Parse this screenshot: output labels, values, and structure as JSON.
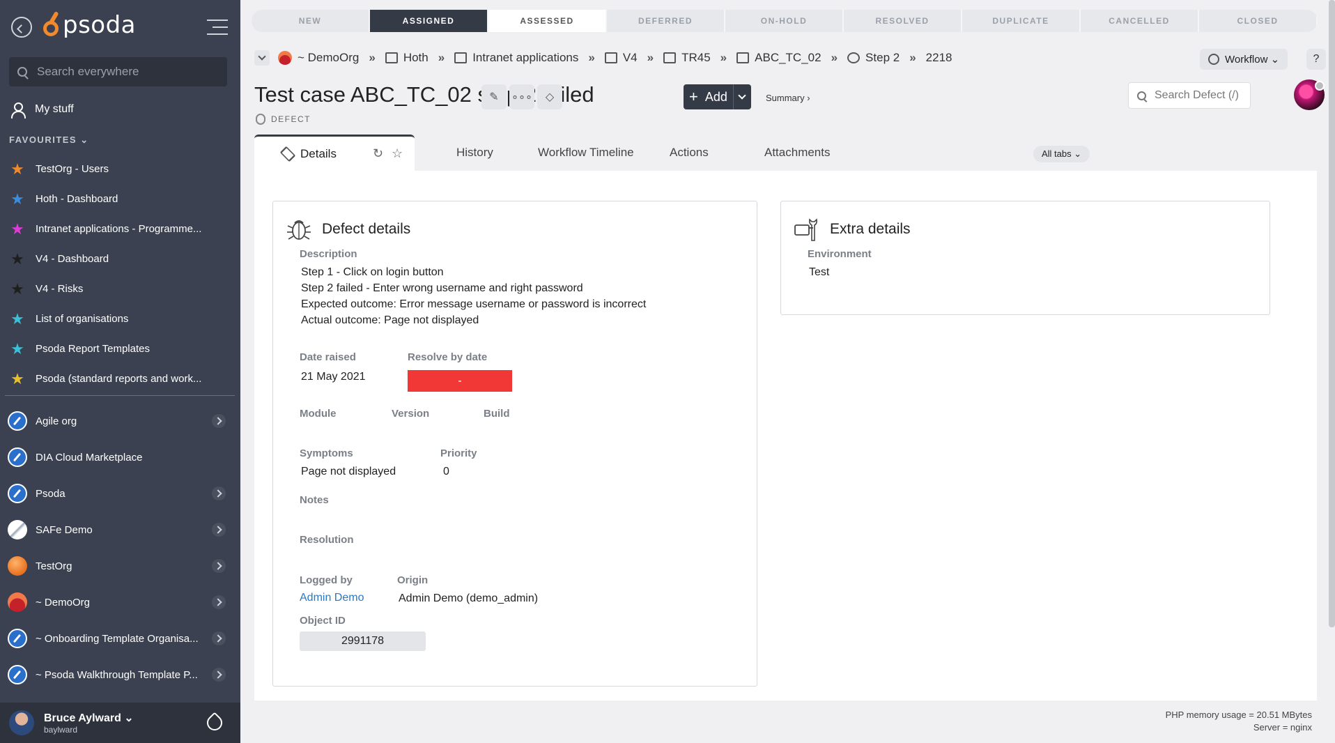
{
  "sidebar": {
    "logo_text": "psoda",
    "search_placeholder": "Search everywhere",
    "my_stuff": "My stuff",
    "favourites_header": "FAVOURITES ⌄",
    "favourites": [
      {
        "label": "TestOrg - Users",
        "color": "#f08a2c"
      },
      {
        "label": "Hoth - Dashboard",
        "color": "#3b8de0"
      },
      {
        "label": "Intranet applications - Programme...",
        "color": "#e03bd8"
      },
      {
        "label": "V4 - Dashboard",
        "color": "#2a2a2a"
      },
      {
        "label": "V4 - Risks",
        "color": "#2a2a2a"
      },
      {
        "label": "List of organisations",
        "color": "#3ac1d9"
      },
      {
        "label": "Psoda Report Templates",
        "color": "#3ac1d9"
      },
      {
        "label": "Psoda (standard reports and work...",
        "color": "#e8c12a"
      }
    ],
    "orgs": [
      {
        "label": "Agile org",
        "icon": "rocket-icon",
        "chevron": true
      },
      {
        "label": "DIA Cloud Marketplace",
        "icon": "rocket-icon",
        "chevron": false
      },
      {
        "label": "Psoda",
        "icon": "rocket-icon",
        "chevron": true
      },
      {
        "label": "SAFe Demo",
        "icon": "safe-logo-icon",
        "chevron": true
      },
      {
        "label": "TestOrg",
        "icon": "orange-ball-icon",
        "chevron": true
      },
      {
        "label": "~ DemoOrg",
        "icon": "sunset-icon",
        "chevron": true
      },
      {
        "label": "~ Onboarding Template Organisa...",
        "icon": "rocket-icon",
        "chevron": true
      },
      {
        "label": "~ Psoda Walkthrough Template P...",
        "icon": "rocket-icon",
        "chevron": true
      }
    ],
    "user": {
      "name": "Bruce Aylward ⌄",
      "username": "baylward"
    }
  },
  "workflow_stages": [
    {
      "label": "NEW",
      "state": "past"
    },
    {
      "label": "ASSIGNED",
      "state": "active"
    },
    {
      "label": "ASSESSED",
      "state": "current"
    },
    {
      "label": "DEFERRED",
      "state": "future"
    },
    {
      "label": "ON-HOLD",
      "state": "future"
    },
    {
      "label": "RESOLVED",
      "state": "future"
    },
    {
      "label": "DUPLICATE",
      "state": "future"
    },
    {
      "label": "CANCELLED",
      "state": "future"
    },
    {
      "label": "CLOSED",
      "state": "future"
    }
  ],
  "breadcrumb": [
    {
      "label": "~ DemoOrg",
      "icon": "org-icon"
    },
    {
      "label": "Hoth",
      "icon": "portfolio-icon"
    },
    {
      "label": "Intranet applications",
      "icon": "programme-icon"
    },
    {
      "label": "V4",
      "icon": "project-icon"
    },
    {
      "label": "TR45",
      "icon": "test-run-icon"
    },
    {
      "label": "ABC_TC_02",
      "icon": "test-case-icon"
    },
    {
      "label": "Step 2",
      "icon": "step-icon"
    },
    {
      "label": "2218",
      "icon": ""
    }
  ],
  "header": {
    "title": "Test case ABC_TC_02 step 2 failed",
    "type_label": "DEFECT",
    "add_label": "Add",
    "summary_link": "Summary ›",
    "workflow_label": "Workflow ⌄",
    "help_label": "?",
    "search_placeholder": "Search Defect (/)"
  },
  "tabs": {
    "details": "Details",
    "history": "History",
    "workflow_timeline": "Workflow Timeline",
    "actions": "Actions",
    "attachments": "Attachments",
    "all_tabs": "All tabs ⌄"
  },
  "defect_details": {
    "title": "Defect details",
    "description_label": "Description",
    "description_lines": [
      "Step 1 - Click on login button",
      "Step 2 failed - Enter wrong username and right password",
      "Expected outcome: Error message username or password is incorrect",
      "Actual outcome: Page not displayed"
    ],
    "date_raised_label": "Date raised",
    "date_raised": "21 May 2021",
    "resolve_by_label": "Resolve by date",
    "resolve_by": "-",
    "module_label": "Module",
    "version_label": "Version",
    "build_label": "Build",
    "symptoms_label": "Symptoms",
    "symptoms": "Page not displayed",
    "priority_label": "Priority",
    "priority": "0",
    "notes_label": "Notes",
    "resolution_label": "Resolution",
    "logged_by_label": "Logged by",
    "logged_by": "Admin Demo",
    "origin_label": "Origin",
    "origin": "Admin Demo (demo_admin)",
    "object_id_label": "Object ID",
    "object_id": "2991178"
  },
  "extra_details": {
    "title": "Extra details",
    "environment_label": "Environment",
    "environment": "Test"
  },
  "footer": {
    "memory": "PHP memory usage = 20.51 MBytes",
    "server": "Server = nginx"
  },
  "colors": {
    "sidebar": "#3b4150",
    "accent": "#353a47",
    "overdue": "#f23737",
    "link": "#2a78c5"
  }
}
